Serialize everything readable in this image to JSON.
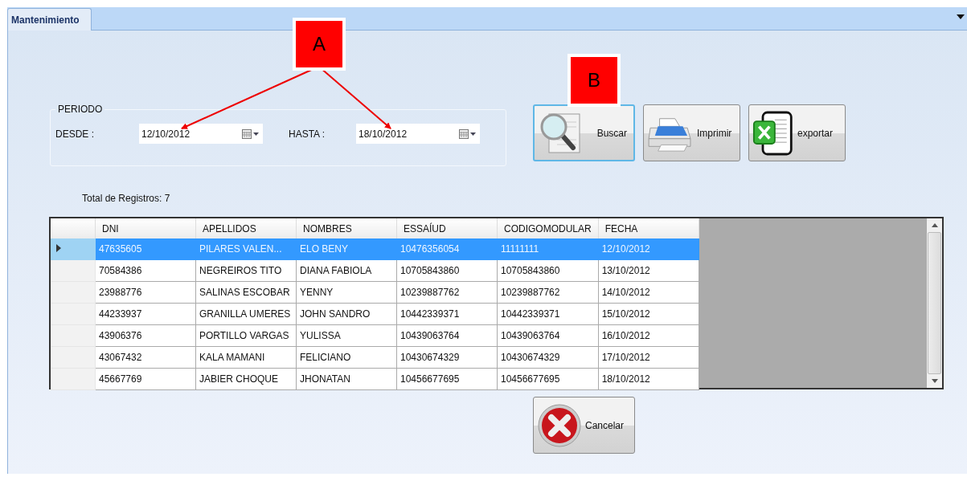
{
  "tab": {
    "label": "Mantenimiento",
    "selected": true
  },
  "periodo": {
    "title": "PERIODO",
    "desde_label": "DESDE :",
    "desde_value": "12/10/2012",
    "hasta_label": "HASTA :",
    "hasta_value": "18/10/2012"
  },
  "buttons": [
    {
      "kind": "search",
      "label": "Buscar",
      "focused": true
    },
    {
      "kind": "print",
      "label": "Imprimir",
      "focused": false
    },
    {
      "kind": "export",
      "label": "exportar",
      "focused": false
    }
  ],
  "total": "Total de Registros: 7",
  "table": {
    "columns": [
      "DNI",
      "APELLIDOS",
      "NOMBRES",
      "ESSAÍUD",
      "CODIGOMODULAR",
      "FECHA"
    ],
    "rows": [
      {
        "selected": true,
        "cells": [
          "47635605",
          "PILARES VALEN...",
          "ELO BENY",
          "10476356054",
          "11111111",
          "12/10/2012"
        ]
      },
      {
        "selected": false,
        "cells": [
          "70584386",
          "NEGREIROS TITO",
          "DIANA FABIOLA",
          "10705843860",
          "10705843860",
          "13/10/2012"
        ]
      },
      {
        "selected": false,
        "cells": [
          "23988776",
          "SALINAS ESCOBAR",
          "YENNY",
          "10239887762",
          "10239887762",
          "14/10/2012"
        ]
      },
      {
        "selected": false,
        "cells": [
          "44233937",
          "GRANILLA UMERES",
          "JOHN SANDRO",
          "10442339371",
          "10442339371",
          "15/10/2012"
        ]
      },
      {
        "selected": false,
        "cells": [
          "43906376",
          "PORTILLO VARGAS",
          "YULISSA",
          "10439063764",
          "10439063764",
          "16/10/2012"
        ]
      },
      {
        "selected": false,
        "cells": [
          "43067432",
          "KALA MAMANI",
          "FELICIANO",
          "10430674329",
          "10430674329",
          "17/10/2012"
        ]
      },
      {
        "selected": false,
        "cells": [
          "45667769",
          "JABIER CHOQUE",
          "JHONATAN",
          "10456677695",
          "10456677695",
          "18/10/2012"
        ]
      }
    ]
  },
  "cancel_button": {
    "label": "Cancelar"
  },
  "callouts": [
    {
      "label": "A"
    },
    {
      "label": "B"
    }
  ]
}
